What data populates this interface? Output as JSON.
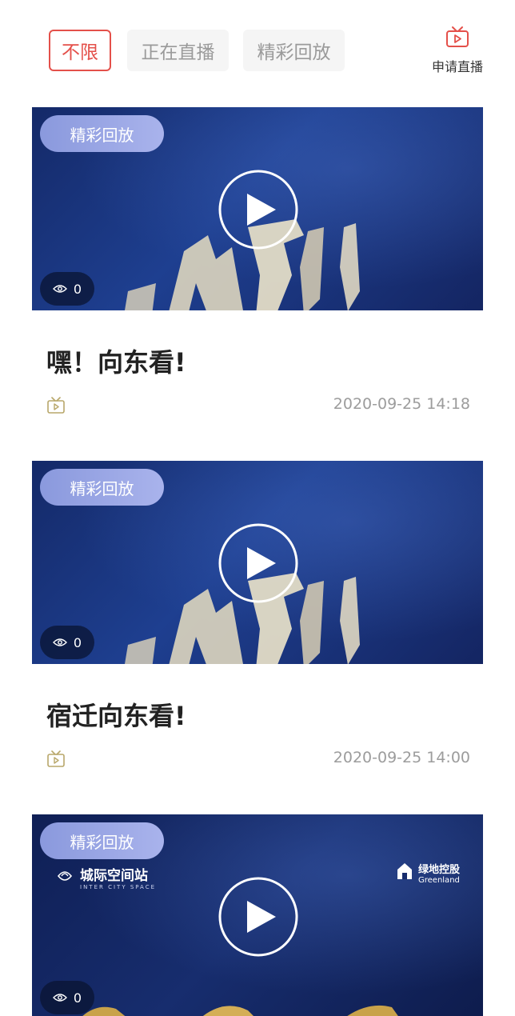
{
  "filters": {
    "tabs": [
      {
        "label": "不限",
        "active": true
      },
      {
        "label": "正在直播",
        "active": false
      },
      {
        "label": "精彩回放",
        "active": false
      }
    ],
    "apply_label": "申请直播",
    "accent_color": "#e4504a"
  },
  "feed": [
    {
      "badge": "精彩回放",
      "views": "0",
      "title": "嘿！向东看!",
      "time": "2020-09-25 14:18"
    },
    {
      "badge": "精彩回放",
      "views": "0",
      "title": "宿迁向东看!",
      "time": "2020-09-25 14:00"
    },
    {
      "badge": "精彩回放",
      "views": "0",
      "brand_left": "城际空间站",
      "brand_left_sub": "INTER CITY SPACE",
      "brand_right": "绿地控股",
      "brand_right_sub": "Greenland"
    }
  ],
  "icons": {
    "apply": "tv-icon",
    "play": "play-icon",
    "views": "eye-icon",
    "meta": "tv-icon"
  }
}
